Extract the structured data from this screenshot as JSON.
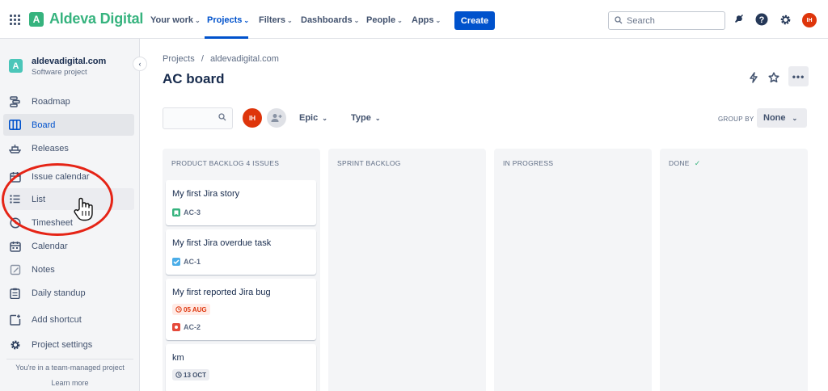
{
  "topnav": {
    "brand": "Aldeva Digital",
    "brand_initial": "A",
    "items": [
      {
        "label": "Your work"
      },
      {
        "label": "Projects"
      },
      {
        "label": "Filters"
      },
      {
        "label": "Dashboards"
      },
      {
        "label": "People"
      },
      {
        "label": "Apps"
      }
    ],
    "active_item": "Projects",
    "create_label": "Create",
    "search_placeholder": "Search",
    "user_initials": "IH",
    "accent": "#0052cc",
    "brand_color": "#36b37e"
  },
  "sidebar": {
    "project_name": "aldevadigital.com",
    "project_type": "Software project",
    "project_initial": "A",
    "items": [
      {
        "label": "Roadmap",
        "icon": "roadmap-icon"
      },
      {
        "label": "Board",
        "icon": "board-icon",
        "active": true
      },
      {
        "label": "Releases",
        "icon": "ship-icon"
      },
      {
        "label": "Issue calendar",
        "icon": "calendar-icon"
      },
      {
        "label": "List",
        "icon": "list-icon",
        "hovered": true
      },
      {
        "label": "Timesheet",
        "icon": "clock-icon"
      },
      {
        "label": "Calendar",
        "icon": "calendar-icon"
      },
      {
        "label": "Notes",
        "icon": "notes-icon"
      },
      {
        "label": "Daily standup",
        "icon": "clipboard-icon"
      },
      {
        "label": "Add shortcut",
        "icon": "add-shortcut-icon"
      },
      {
        "label": "Project settings",
        "icon": "gear-icon"
      }
    ],
    "footer_text": "You're in a team-managed project",
    "footer_link": "Learn more"
  },
  "main": {
    "breadcrumb": [
      "Projects",
      "aldevadigital.com"
    ],
    "breadcrumb_sep": "/",
    "title": "AC board",
    "more_label": "•••",
    "filters": {
      "avatar_initials": "IH",
      "epic_label": "Epic",
      "type_label": "Type",
      "group_by_label": "GROUP BY",
      "group_by_value": "None"
    },
    "columns": [
      {
        "title": "PRODUCT BACKLOG 4 ISSUES"
      },
      {
        "title": "SPRINT BACKLOG"
      },
      {
        "title": "IN PROGRESS"
      },
      {
        "title": "DONE"
      }
    ],
    "cards": [
      {
        "title": "My first Jira story",
        "key": "AC-3",
        "type": "story",
        "type_color": "#36b37e"
      },
      {
        "title": "My first Jira overdue task",
        "key": "AC-1",
        "type": "task",
        "type_color": "#4bade8"
      },
      {
        "title": "My first reported Jira bug",
        "due": "05 AUG",
        "due_overdue": true,
        "key": "AC-2",
        "type": "bug",
        "type_color": "#e5493a"
      },
      {
        "title": "km",
        "due": "13 OCT"
      }
    ]
  }
}
